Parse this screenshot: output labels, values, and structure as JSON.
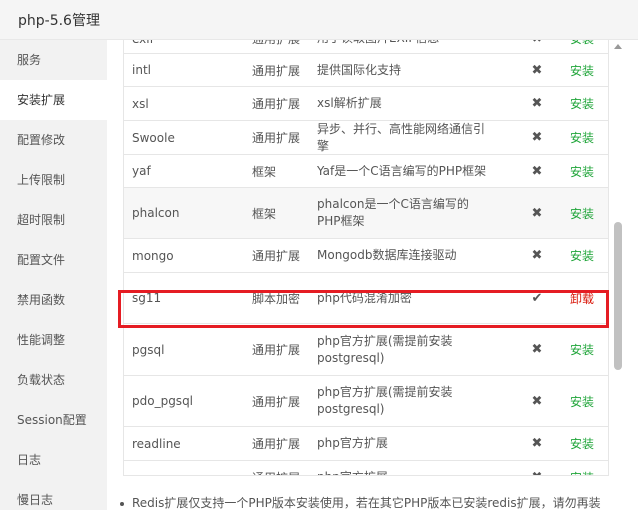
{
  "window": {
    "title": "php-5.6管理"
  },
  "sidebar": {
    "items": [
      {
        "label": "服务"
      },
      {
        "label": "安装扩展"
      },
      {
        "label": "配置修改"
      },
      {
        "label": "上传限制"
      },
      {
        "label": "超时限制"
      },
      {
        "label": "配置文件"
      },
      {
        "label": "禁用函数"
      },
      {
        "label": "性能调整"
      },
      {
        "label": "负载状态"
      },
      {
        "label": "Session配置"
      },
      {
        "label": "日志"
      },
      {
        "label": "慢日志"
      }
    ],
    "active_index": 1
  },
  "table": {
    "rows": [
      {
        "name": "exif",
        "type": "通用扩展",
        "desc": "用于读取图片EXIF信息",
        "installed": false,
        "action": "安装"
      },
      {
        "name": "intl",
        "type": "通用扩展",
        "desc": "提供国际化支持",
        "installed": false,
        "action": "安装"
      },
      {
        "name": "xsl",
        "type": "通用扩展",
        "desc": "xsl解析扩展",
        "installed": false,
        "action": "安装"
      },
      {
        "name": "Swoole",
        "type": "通用扩展",
        "desc": "异步、并行、高性能网络通信引擎",
        "installed": false,
        "action": "安装"
      },
      {
        "name": "yaf",
        "type": "框架",
        "desc": "Yaf是一个C语言编写的PHP框架",
        "installed": false,
        "action": "安装"
      },
      {
        "name": "phalcon",
        "type": "框架",
        "desc": "phalcon是一个C语言编写的PHP框架",
        "installed": false,
        "action": "安装"
      },
      {
        "name": "mongo",
        "type": "通用扩展",
        "desc": "Mongodb数据库连接驱动",
        "installed": false,
        "action": "安装"
      },
      {
        "name": "sg11",
        "type": "脚本加密",
        "desc": "php代码混淆加密",
        "installed": true,
        "action": "卸载"
      },
      {
        "name": "pgsql",
        "type": "通用扩展",
        "desc": "php官方扩展(需提前安装postgresql)",
        "installed": false,
        "action": "安装"
      },
      {
        "name": "pdo_pgsql",
        "type": "通用扩展",
        "desc": "php官方扩展(需提前安装postgresql)",
        "installed": false,
        "action": "安装"
      },
      {
        "name": "readline",
        "type": "通用扩展",
        "desc": "php官方扩展",
        "installed": false,
        "action": "安装"
      },
      {
        "name": "snmp",
        "type": "通用扩展",
        "desc": "php官方扩展",
        "installed": false,
        "action": "安装"
      }
    ]
  },
  "icons": {
    "installed": "check-icon",
    "not_installed": "cross-icon"
  },
  "colors": {
    "install": "#20a53a",
    "uninstall": "#d9170a",
    "highlight": "#e51c23"
  },
  "note": {
    "text": "Redis扩展仅支持一个PHP版本安装使用，若在其它PHP版本已安装redis扩展，请勿再装"
  }
}
